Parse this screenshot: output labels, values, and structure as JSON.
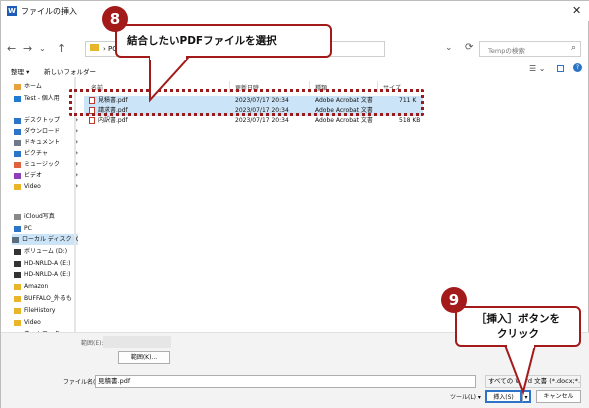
{
  "window": {
    "title": "ファイルの挿入",
    "app_icon": "W"
  },
  "nav": {
    "path": [
      "PC",
      "ロ"
    ],
    "search_placeholder": "Tempの検索"
  },
  "commands": {
    "organize": "整理 ▾",
    "new_folder": "新しいフォルダー"
  },
  "sidebar": {
    "items": [
      {
        "label": "ホーム",
        "icon": "home-icon",
        "color": "#e8a23b"
      },
      {
        "label": "Test - 個人用",
        "icon": "cloud-icon",
        "color": "#1f7ad1"
      },
      {
        "label": "デスクトップ",
        "icon": "desktop-icon",
        "color": "#2b74c8",
        "pinned": true
      },
      {
        "label": "ダウンロード",
        "icon": "download-icon",
        "color": "#2b74c8",
        "pinned": true
      },
      {
        "label": "ドキュメント",
        "icon": "documents-icon",
        "color": "#6f7a86",
        "pinned": true
      },
      {
        "label": "ピクチャ",
        "icon": "pictures-icon",
        "color": "#2b74c8",
        "pinned": true
      },
      {
        "label": "ミュージック",
        "icon": "music-icon",
        "color": "#e0613d",
        "pinned": true
      },
      {
        "label": "ビデオ",
        "icon": "videos-icon",
        "color": "#8d3fb8",
        "pinned": true
      },
      {
        "label": "Video",
        "icon": "folder-icon",
        "color": "#e8b52a",
        "pinned": true
      },
      {
        "label": "iCloud写真",
        "icon": "icloud-icon",
        "color": "#888888"
      },
      {
        "label": "PC",
        "icon": "pc-icon",
        "color": "#2b74c8"
      },
      {
        "label": "ローカル ディスク (C",
        "icon": "disk-icon",
        "color": "#5b6c7c",
        "selected": true
      },
      {
        "label": "ボリューム (D:)",
        "icon": "drive-icon",
        "color": "#333333"
      },
      {
        "label": "HD-NRLD-A (E:)",
        "icon": "drive-icon",
        "color": "#333333"
      },
      {
        "label": "HD-NRLD-A (E:)",
        "icon": "drive-icon",
        "color": "#333333"
      },
      {
        "label": "Amazon",
        "icon": "folder-icon",
        "color": "#e8b52a"
      },
      {
        "label": "BUFFALO_外るも",
        "icon": "folder-icon",
        "color": "#e8b52a"
      },
      {
        "label": "FileHistory",
        "icon": "folder-icon",
        "color": "#e8b52a"
      },
      {
        "label": "Video",
        "icon": "folder-icon",
        "color": "#e8b52a"
      },
      {
        "label": "ネットワーク",
        "icon": "network-icon",
        "color": "#2b74c8"
      }
    ]
  },
  "columns": [
    "名前",
    "更新日時",
    "種類",
    "サイズ"
  ],
  "files": [
    {
      "name": "見積書.pdf",
      "date": "2023/07/17 20:34",
      "type": "Adobe Acrobat 文書",
      "size": "711 K",
      "selected": true
    },
    {
      "name": "請求書.pdf",
      "date": "2023/07/17 20:34",
      "type": "Adobe Acrobat 文書",
      "size": "",
      "selected": true
    },
    {
      "name": "内訳書.pdf",
      "date": "2023/07/17 20:34",
      "type": "Adobe Acrobat 文書",
      "size": "518 KB",
      "selected": false
    }
  ],
  "range": {
    "label": "範囲(E):",
    "button": "範囲(K)..."
  },
  "footer": {
    "filename_label": "ファイル名(N):",
    "filename_value": "見積書.pdf",
    "filetype_value": "すべての Word 文書 (*.docx;*.doc",
    "tools": "ツール(L) ▾",
    "insert": "挿入(S)",
    "cancel": "キャンセル"
  },
  "annotations": {
    "step8_number": "8",
    "step8_text": "結合したいPDFファイルを選択",
    "step9_number": "9",
    "step9_line1": "［挿入］ボタンを",
    "step9_line2": "クリック"
  },
  "colors": {
    "accent": "#a31a1a",
    "selection": "#cce4f7",
    "folder": "#e8b52a"
  }
}
